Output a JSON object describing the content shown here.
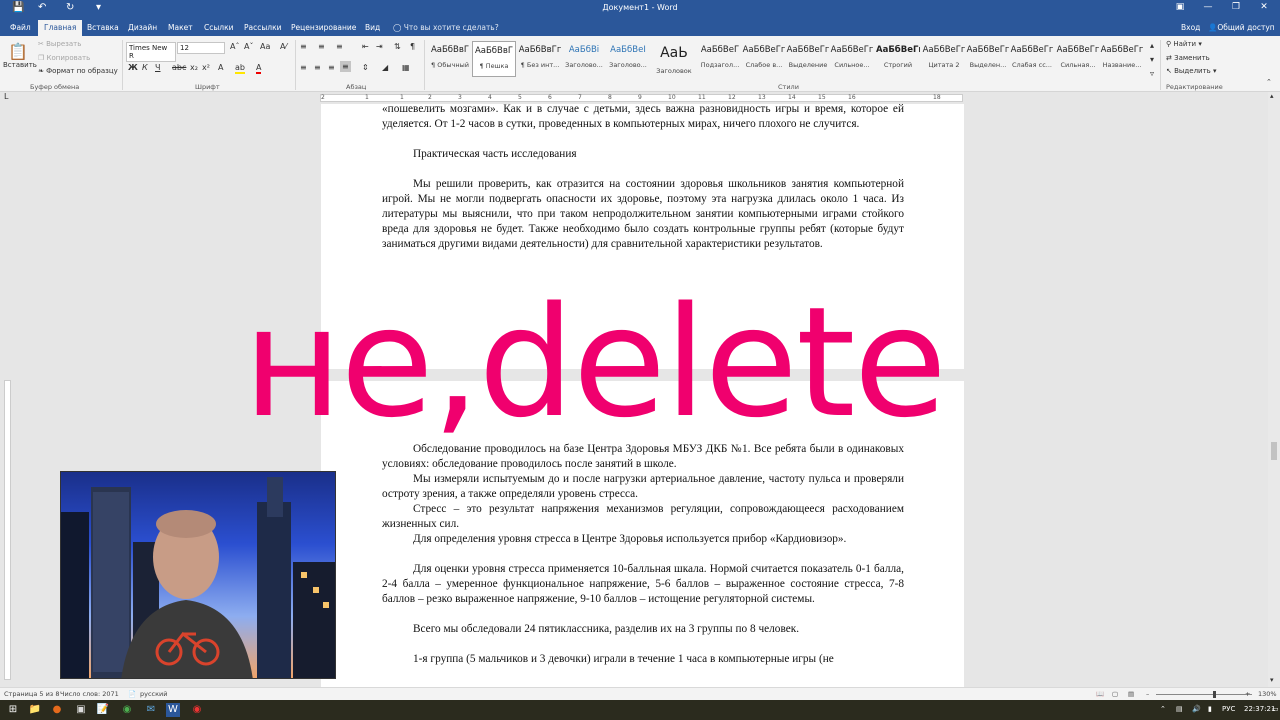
{
  "window": {
    "title": "Документ1 - Word"
  },
  "tabs": [
    "Файл",
    "Главная",
    "Вставка",
    "Дизайн",
    "Макет",
    "Ссылки",
    "Рассылки",
    "Рецензирование",
    "Вид"
  ],
  "active_tab": "Главная",
  "tell_me": "Что вы хотите сделать?",
  "account": {
    "login": "Вход",
    "share": "Общий доступ"
  },
  "ribbon": {
    "clipboard": {
      "paste": "Вставить",
      "cut": "Вырезать",
      "copy": "Копировать",
      "format_painter": "Формат по образцу",
      "group": "Буфер обмена"
    },
    "font": {
      "family": "Times New R",
      "size": "12",
      "group": "Шрифт"
    },
    "paragraph": {
      "group": "Абзац"
    },
    "styles": {
      "group": "Стили",
      "items": [
        {
          "preview": "АаБбВвГ",
          "name": "¶ Обычный"
        },
        {
          "preview": "АаБбВвГ",
          "name": "¶ Пешка"
        },
        {
          "preview": "АаБбВвГг",
          "name": "¶ Без инт..."
        },
        {
          "preview": "АаБбВі",
          "name": "Заголово..."
        },
        {
          "preview": "АаБбВеІ",
          "name": "Заголово..."
        },
        {
          "preview": "АаЬ",
          "name": "Заголовок"
        },
        {
          "preview": "АаБбВеГ",
          "name": "Подзагол..."
        },
        {
          "preview": "АаБбВеГг",
          "name": "Слабое в..."
        },
        {
          "preview": "АаБбВеГг",
          "name": "Выделение"
        },
        {
          "preview": "АаБбВеГг",
          "name": "Сильное..."
        },
        {
          "preview": "АаБбВеГг",
          "name": "Строгий"
        },
        {
          "preview": "АаБбВеГг",
          "name": "Цитата 2"
        },
        {
          "preview": "АаБбВеГг",
          "name": "Выделен..."
        },
        {
          "preview": "АаБбВеГг",
          "name": "Слабая сс..."
        },
        {
          "preview": "АаБбВеГг",
          "name": "Сильная..."
        },
        {
          "preview": "АаБбВеГг",
          "name": "Название..."
        }
      ]
    },
    "editing": {
      "find": "Найти",
      "replace": "Заменить",
      "select": "Выделить",
      "group": "Редактирование"
    }
  },
  "ruler_numbers": [
    "2",
    "1",
    "1",
    "2",
    "3",
    "4",
    "5",
    "6",
    "7",
    "8",
    "9",
    "10",
    "11",
    "12",
    "13",
    "14",
    "15",
    "16",
    "18"
  ],
  "page1": {
    "paragraphs": [
      "«пошевелить мозгами». Как и в случае с детьми, здесь важна разновидность игры и время, которое ей уделяется. От 1-2 часов в сутки, проведенных в компьютерных мирах, ничего плохого не случится.",
      "",
      "Практическая часть исследования",
      "",
      "Мы решили проверить, как отразится на состоянии здоровья школьников занятия компьютерной игрой. Мы не могли подвергать опасности их здоровье, поэтому эта нагрузка длилась около 1 часа. Из литературы мы выяснили, что при таком непродолжительном занятии компьютерными играми стойкого вреда для здоровья не будет. Также необходимо было создать контрольные группы ребят (которые будут заниматься другими видами деятельности) для сравнительной характеристики результатов."
    ]
  },
  "page2": {
    "paragraphs": [
      "Обследование проводилось на базе Центра Здоровья МБУЗ ДКБ №1. Все ребята были в одинаковых условиях: обследование проводилось после занятий в школе.",
      "Мы измеряли испытуемым до и после нагрузки артериальное давление, частоту пульса и проверяли остроту зрения, а также определяли уровень стресса.",
      "Стресс – это результат напряжения механизмов регуляции, сопровождающееся расходованием жизненных сил.",
      "Для определения уровня стресса в Центре Здоровья используется прибор «Кардиовизор».",
      "",
      "Для оценки уровня стресса применяется 10-балльная шкала. Нормой считается показатель 0-1 балла, 2-4 балла – умеренное функциональное напряжение, 5-6 баллов – выраженное состояние стресса, 7-8 баллов – резко выраженное напряжение, 9-10 баллов – истощение регуляторной системы.",
      "",
      "Всего мы обследовали 24 пятиклассника, разделив их на 3 группы по 8 человек.",
      "",
      "1-я группа (5 мальчиков и 3 девочки) играли в течение 1 часа в компьютерные игры (не"
    ]
  },
  "overlay_text": "не,delete",
  "statusbar": {
    "page": "Страница 5 из 8",
    "words": "Число слов: 2071",
    "language": "русский",
    "zoom": "130%"
  },
  "taskbar": {
    "lang": "РУС",
    "time": "22:37:21"
  },
  "colors": {
    "word_blue": "#2b579a",
    "overlay_pink": "#f0006e"
  }
}
